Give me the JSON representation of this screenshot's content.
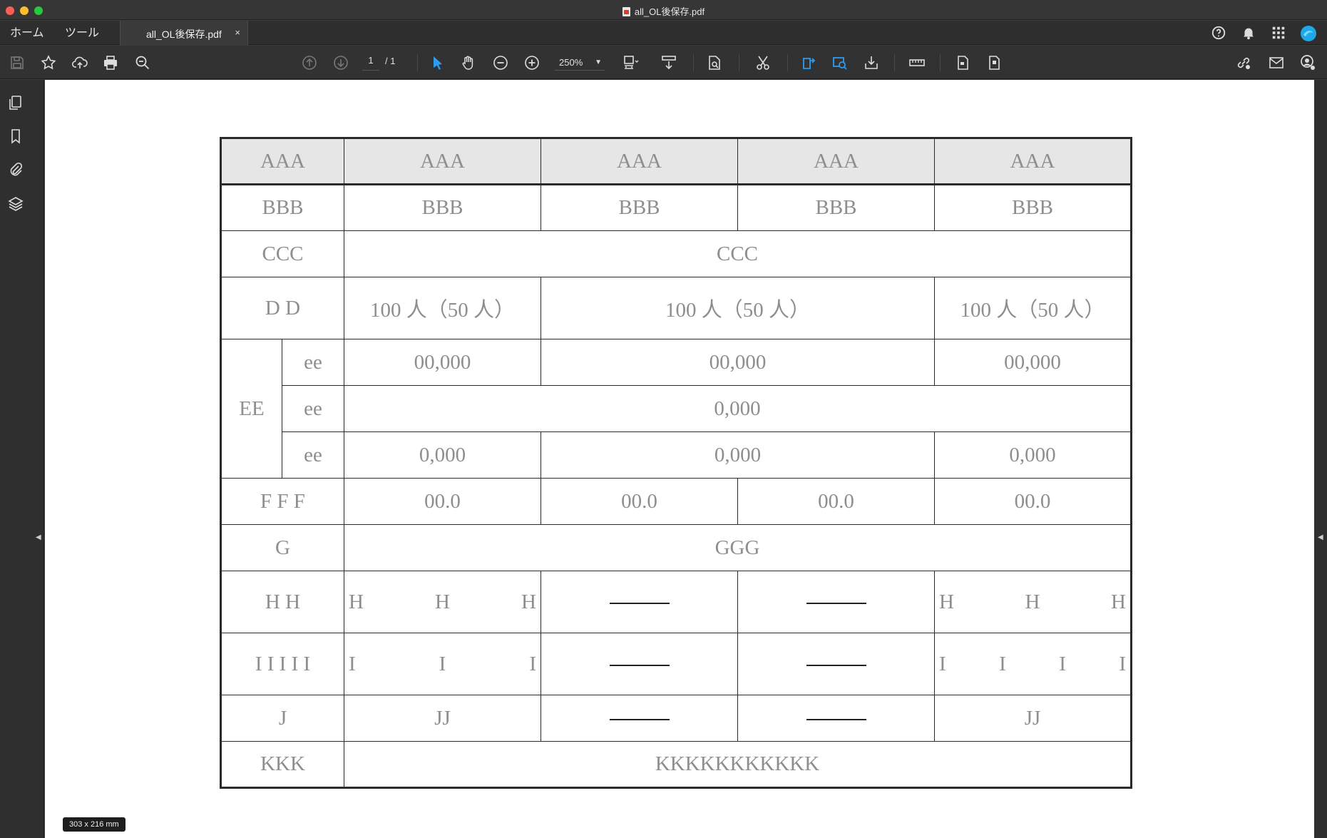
{
  "window": {
    "title": "all_OL後保存.pdf"
  },
  "tabs": {
    "home": "ホーム",
    "tools": "ツール",
    "document": "all_OL後保存.pdf",
    "close": "×"
  },
  "toolbar": {
    "page_current": "1",
    "page_total": "/ 1",
    "zoom": "250%"
  },
  "page_dimensions": "303 x 216 mm",
  "table": {
    "header": [
      "AAA",
      "AAA",
      "AAA",
      "AAA",
      "AAA"
    ],
    "row_b": [
      "BBB",
      "BBB",
      "BBB",
      "BBB",
      "BBB"
    ],
    "row_c": [
      "CCC",
      "CCC"
    ],
    "row_d": [
      "D D",
      "100 人（50 人）",
      "100 人（50 人）",
      "100 人（50 人）"
    ],
    "row_e_label": "EE",
    "row_e1": [
      "ee",
      "00,000",
      "00,000",
      "00,000"
    ],
    "row_e2": [
      "ee",
      "0,000"
    ],
    "row_e3": [
      "ee",
      "0,000",
      "0,000",
      "0,000"
    ],
    "row_f": [
      "F F F",
      "00.0",
      "00.0",
      "00.0",
      "00.0"
    ],
    "row_g": [
      "G",
      "GGG"
    ],
    "row_h": {
      "label": "H H",
      "col1": [
        "H",
        "H",
        "H"
      ],
      "col4": [
        "H",
        "H",
        "H"
      ]
    },
    "row_i": {
      "label": "I I I I I",
      "col1": [
        "I",
        "I",
        "I"
      ],
      "col4": [
        "I",
        "I",
        "I",
        "I"
      ]
    },
    "row_j": [
      "J",
      "JJ",
      "JJ"
    ],
    "row_k": [
      "KKK",
      "KKKKKKKKKKK"
    ]
  },
  "colors": {
    "header_fill": "#e6e6e6",
    "cell_text": "#8e8e8e",
    "accent_blue": "#2d9cf0"
  }
}
